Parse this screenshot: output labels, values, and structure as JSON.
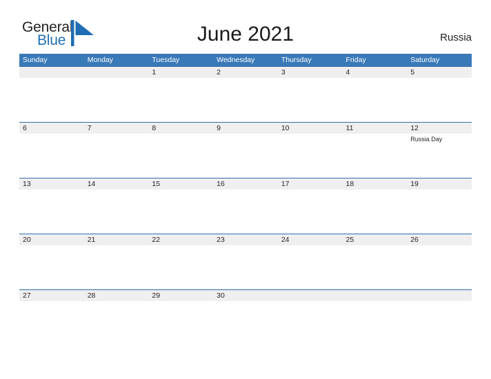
{
  "brand": {
    "name_part1": "General",
    "name_part2": "Blue",
    "mark": "triangle-logo",
    "color_dark": "#231f20",
    "color_blue": "#1f6db4"
  },
  "header": {
    "title": "June 2021",
    "region": "Russia"
  },
  "theme": {
    "header_blue": "#3a79b8",
    "row_line_blue": "#2e6da4",
    "band_grey": "#efeff0",
    "text": "#231f20"
  },
  "calendar": {
    "month": "June",
    "year": "2021",
    "weekday_headers": [
      "Sunday",
      "Monday",
      "Tuesday",
      "Wednesday",
      "Thursday",
      "Friday",
      "Saturday"
    ],
    "weeks": [
      [
        {
          "day": "",
          "event": ""
        },
        {
          "day": "",
          "event": ""
        },
        {
          "day": "1",
          "event": ""
        },
        {
          "day": "2",
          "event": ""
        },
        {
          "day": "3",
          "event": ""
        },
        {
          "day": "4",
          "event": ""
        },
        {
          "day": "5",
          "event": ""
        }
      ],
      [
        {
          "day": "6",
          "event": ""
        },
        {
          "day": "7",
          "event": ""
        },
        {
          "day": "8",
          "event": ""
        },
        {
          "day": "9",
          "event": ""
        },
        {
          "day": "10",
          "event": ""
        },
        {
          "day": "11",
          "event": ""
        },
        {
          "day": "12",
          "event": "Russia Day"
        }
      ],
      [
        {
          "day": "13",
          "event": ""
        },
        {
          "day": "14",
          "event": ""
        },
        {
          "day": "15",
          "event": ""
        },
        {
          "day": "16",
          "event": ""
        },
        {
          "day": "17",
          "event": ""
        },
        {
          "day": "18",
          "event": ""
        },
        {
          "day": "19",
          "event": ""
        }
      ],
      [
        {
          "day": "20",
          "event": ""
        },
        {
          "day": "21",
          "event": ""
        },
        {
          "day": "22",
          "event": ""
        },
        {
          "day": "23",
          "event": ""
        },
        {
          "day": "24",
          "event": ""
        },
        {
          "day": "25",
          "event": ""
        },
        {
          "day": "26",
          "event": ""
        }
      ],
      [
        {
          "day": "27",
          "event": ""
        },
        {
          "day": "28",
          "event": ""
        },
        {
          "day": "29",
          "event": ""
        },
        {
          "day": "30",
          "event": ""
        },
        {
          "day": "",
          "event": ""
        },
        {
          "day": "",
          "event": ""
        },
        {
          "day": "",
          "event": ""
        }
      ]
    ]
  }
}
